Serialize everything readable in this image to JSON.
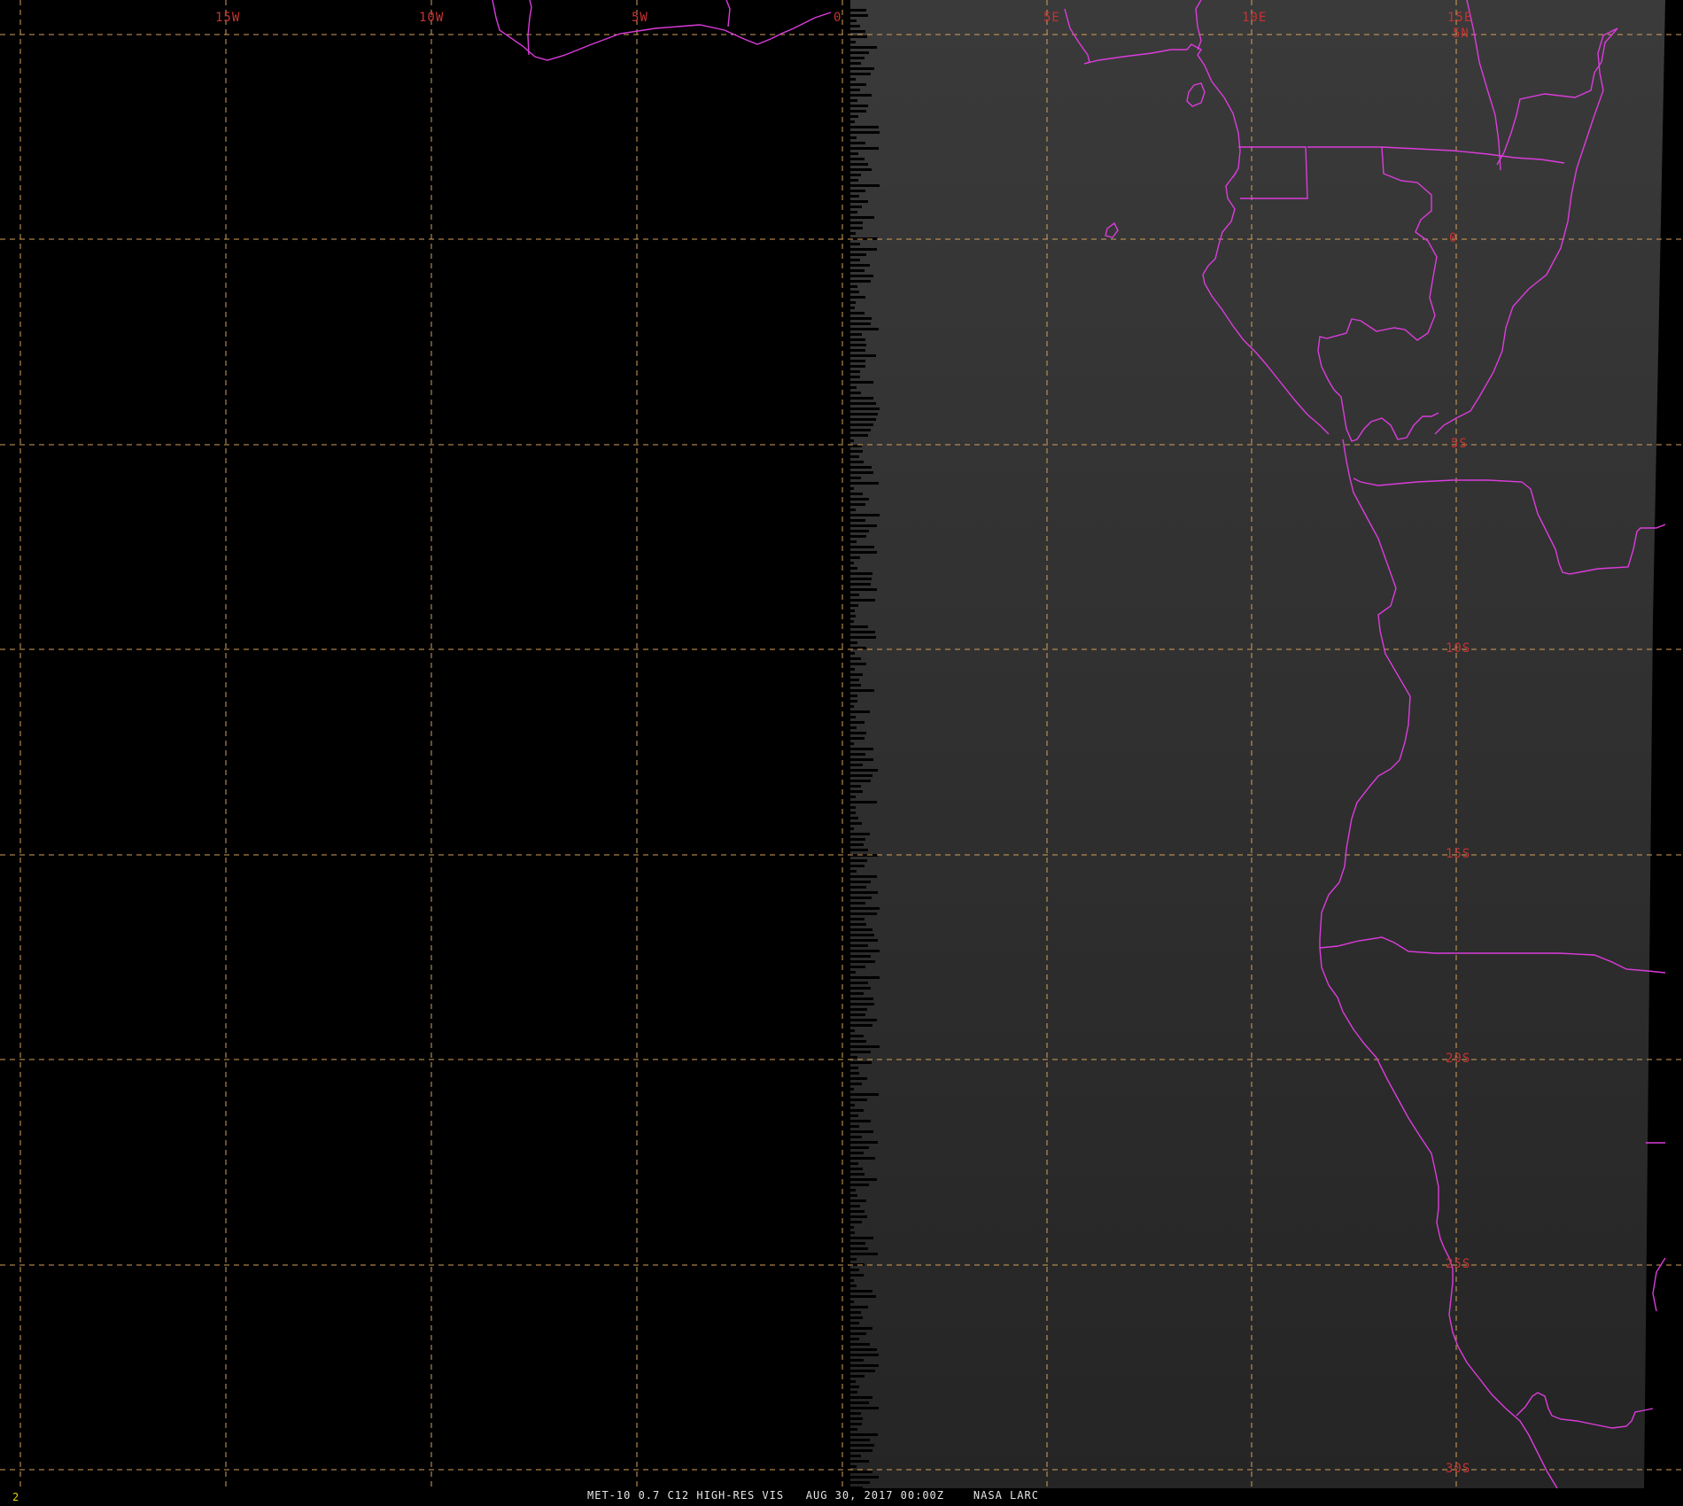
{
  "image_info": {
    "frame_number": "2",
    "caption_text": "MET-10 0.7 C12 HIGH-RES VIS   AUG 30, 2017 00:00Z    NASA LARC"
  },
  "map": {
    "grid": {
      "longitudes_labels": [
        "15W",
        "10W",
        "5W",
        "0",
        "5E",
        "10E",
        "15E"
      ],
      "latitudes_labels": [
        "5N",
        "0",
        "5S",
        "10S",
        "15S",
        "20S",
        "25S",
        "30S"
      ],
      "line_style": "dashed"
    },
    "colors": {
      "background_space": "#000000",
      "earth_disk": "#2a2a2a",
      "grid_line": "#d2a05a",
      "grid_label": "#c83232",
      "coastline_border": "#dc3cdc",
      "caption_text": "#e6e6e6",
      "frame_number": "#e6d200"
    }
  }
}
